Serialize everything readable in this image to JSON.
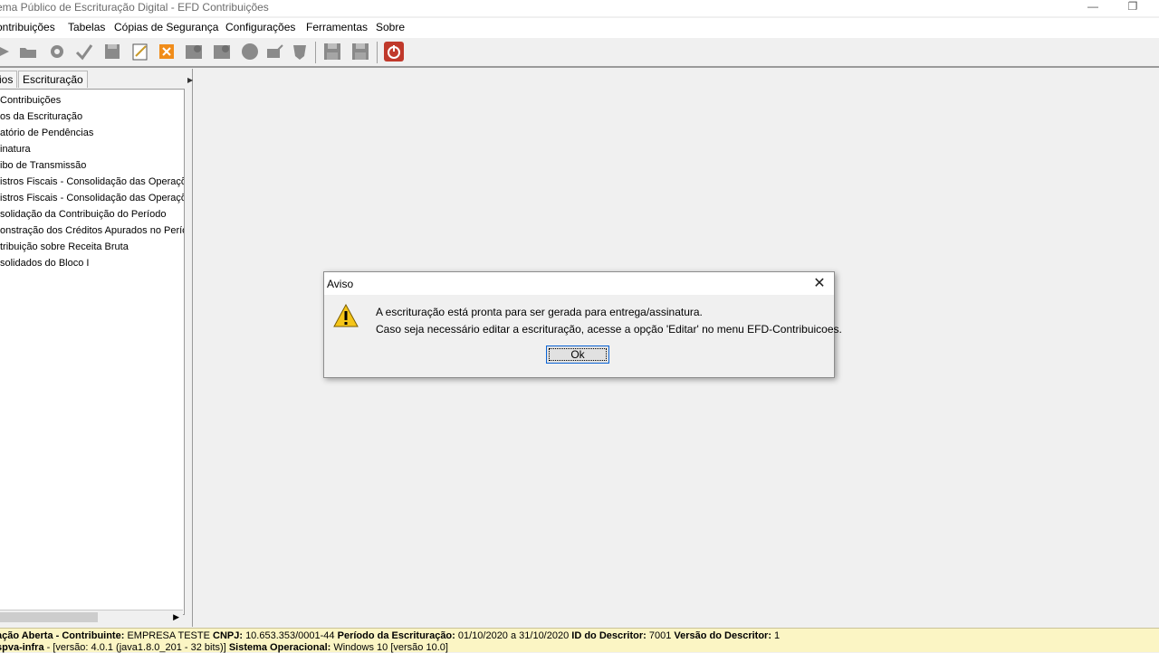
{
  "window": {
    "title": "ema Público de Escrituração Digital - EFD Contribuições",
    "minimize_glyph": "—",
    "restore_glyph": "❐"
  },
  "menu": [
    {
      "label": "ontribuições",
      "icon": ""
    },
    {
      "label": "Tabelas"
    },
    {
      "label": "Cópias de Segurança"
    },
    {
      "label": "Configurações"
    },
    {
      "label": "Ferramentas"
    },
    {
      "label": "Sobre"
    }
  ],
  "toolbar": {
    "icons": [
      "arrow-icon",
      "open-folder-icon",
      "gear-icon",
      "check-icon",
      "save-icon",
      "edit-document-icon",
      "close-x-icon",
      "validate-icon",
      "settings-icon",
      "globe-icon",
      "sign-icon",
      "shield-icon",
      "backup-icon",
      "restore-icon",
      "power-icon"
    ],
    "accent_close": "#f08c1a",
    "accent_power": "#c0392b"
  },
  "left_panel": {
    "tabs": [
      "ios",
      "Escrituração"
    ],
    "tree_items": [
      " Contribuições",
      "os da Escrituração",
      "atório de Pendências",
      "inatura",
      "ibo de Transmissão",
      "istros Fiscais - Consolidação das Operaçõ",
      "istros Fiscais - Consolidação das Operaçõ",
      "solidação da Contribuição do Período",
      "onstração dos Créditos Apurados no Perío",
      "tribuição sobre Receita Bruta",
      "solidados do Bloco I"
    ]
  },
  "status": {
    "line1": [
      {
        "text": "ação Aberta - Contribuinte: ",
        "bold": true
      },
      {
        "text": "EMPRESA TESTE ",
        "bold": false
      },
      {
        "text": "CNPJ: ",
        "bold": true
      },
      {
        "text": "10.653.353/0001-44 ",
        "bold": false
      },
      {
        "text": "Período da Escrituração: ",
        "bold": true
      },
      {
        "text": "01/10/2020 a 31/10/2020 ",
        "bold": false
      },
      {
        "text": "ID do Descritor: ",
        "bold": true
      },
      {
        "text": "7001 ",
        "bold": false
      },
      {
        "text": "Versão do Descritor: ",
        "bold": true
      },
      {
        "text": "1",
        "bold": false
      }
    ],
    "line2": [
      {
        "text": "spva-infra",
        "bold": true
      },
      {
        "text": " - [versão: 4.0.1 (java1.8.0_201 - 32 bits)] ",
        "bold": false
      },
      {
        "text": "Sistema Operacional: ",
        "bold": true
      },
      {
        "text": "Windows 10 [versão 10.0]",
        "bold": false
      }
    ],
    "background": "#fbf5c4"
  },
  "dialog": {
    "title": "Aviso",
    "close_glyph": "✕",
    "message_line1": "A escrituração está pronta para ser gerada para entrega/assinatura.",
    "message_line2": "Caso seja necessário editar a escrituração, acesse a opção 'Editar' no menu EFD-Contribuicoes.",
    "ok_label": "Ok",
    "icon": "warning-icon"
  }
}
